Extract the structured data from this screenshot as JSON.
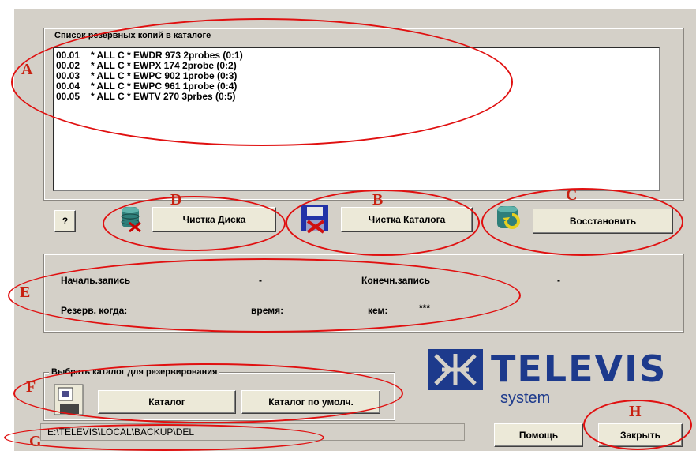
{
  "backup_list": {
    "title": "Список резервных копий в каталоге",
    "items": [
      {
        "id": "00.01",
        "text": "* ALL C * EWDR 973 2probes (0:1)"
      },
      {
        "id": "00.02",
        "text": "* ALL C * EWPX 174 2probe (0:2)"
      },
      {
        "id": "00.03",
        "text": "* ALL C * EWPC 902 1probe (0:3)"
      },
      {
        "id": "00.04",
        "text": "* ALL C * EWPC 961 1probe (0:4)"
      },
      {
        "id": "00.05",
        "text": "* ALL C * EWTV 270 3prbes (0:5)"
      }
    ]
  },
  "buttons": {
    "help_q": "?",
    "clean_disk": "Чистка Диска",
    "clean_catalog": "Чистка Каталога",
    "restore": "Восстановить",
    "catalog": "Каталог",
    "catalog_default": "Каталог по умолч.",
    "help": "Помощь",
    "close": "Закрыть"
  },
  "info": {
    "start_label": "Началь.запись",
    "start_value": "-",
    "end_label": "Конечн.запись",
    "end_value": "-",
    "backup_when_label": "Резерв. когда:",
    "time_label": "время:",
    "by_label": "кем:",
    "by_value": "***"
  },
  "select_catalog": {
    "title": "Выбрать каталог для резервирования"
  },
  "path": "E:\\TELEVIS\\LOCAL\\BACKUP\\DEL",
  "logo": {
    "brand": "TELEVIS",
    "sub": "system"
  },
  "annotations": {
    "a": "A",
    "b": "B",
    "c": "C",
    "d": "D",
    "e": "E",
    "f": "F",
    "g": "G",
    "h": "H"
  },
  "colors": {
    "window_bg": "#d4d0c8",
    "annotation": "#e01010",
    "logo": "#1d3a8c"
  }
}
